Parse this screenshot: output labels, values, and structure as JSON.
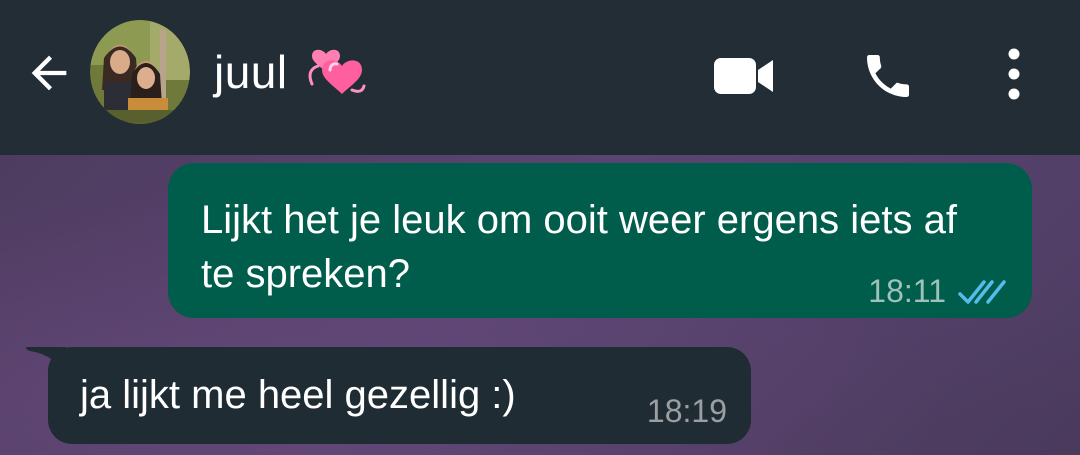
{
  "header": {
    "contact_name": "juul",
    "icons": {
      "back": "arrow-left-icon",
      "emoji": "revolving-hearts-icon",
      "video": "video-camera-icon",
      "call": "phone-icon",
      "menu": "more-vertical-icon"
    }
  },
  "messages": [
    {
      "direction": "outgoing",
      "text": "Lijkt het je leuk om ooit weer ergens iets af te spreken?",
      "time": "18:11",
      "status": "read",
      "status_icon": "double-check-icon"
    },
    {
      "direction": "incoming",
      "text": "ja lijkt me heel gezellig :)",
      "time": "18:19"
    }
  ],
  "colors": {
    "header_bg": "#232d36",
    "outgoing_bubble": "#005c4b",
    "incoming_bubble": "#202c33",
    "read_ticks": "#53bdeb",
    "heart_pink": "#ff6fa8"
  }
}
